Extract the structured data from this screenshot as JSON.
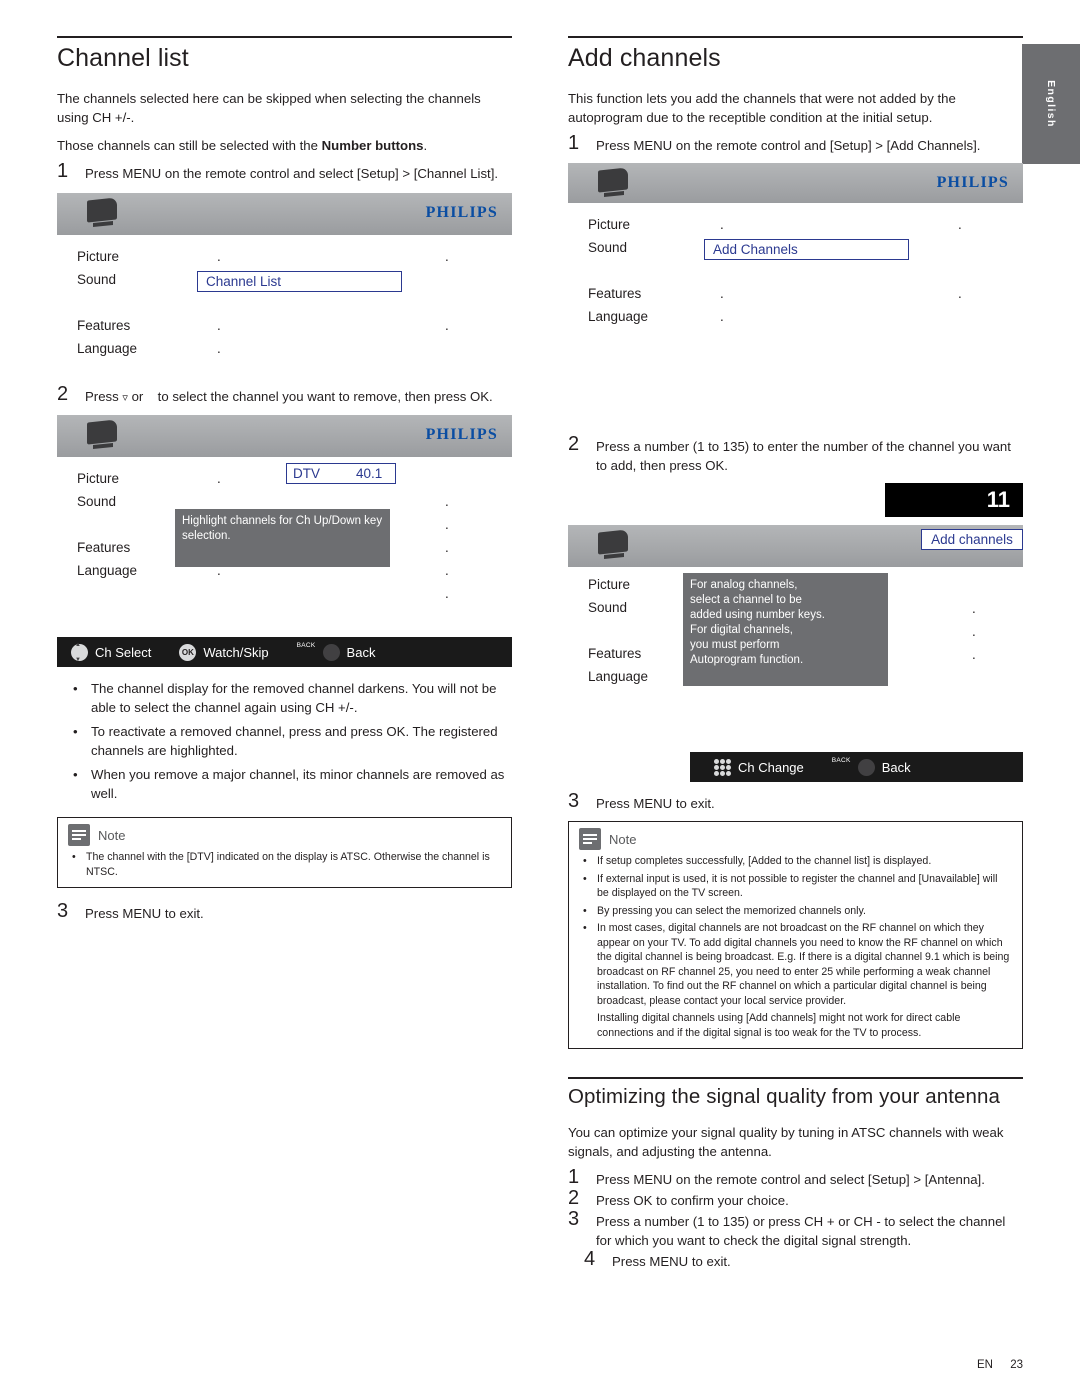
{
  "page": {
    "footer_lang": "EN",
    "footer_page": "23",
    "side_tab": "English"
  },
  "left": {
    "heading": "Channel list",
    "intro1": "The channels selected here can be skipped when selecting the channels using CH +/-.",
    "intro2_a": "Those channels can still be selected with the ",
    "intro2_b": "Number buttons",
    "intro2_c": ".",
    "step1_num": "1",
    "step1": "Press MENU on the remote control and select [Setup] > [Channel List].",
    "osd1": {
      "brand": "PHILIPS",
      "menu": [
        "Picture",
        "Sound",
        "Features",
        "Language"
      ],
      "dots": [
        ".",
        ".",
        ".",
        "."
      ],
      "dots_right": [
        ".",
        ".",
        "."
      ],
      "highlight": "Channel List"
    },
    "step2_num": "2",
    "step2_pre": "Press",
    "step2_mid": "or",
    "step2_post": "to select the channel you want to remove, then press OK.",
    "osd2": {
      "brand": "PHILIPS",
      "menu": [
        "Picture",
        "Sound",
        "Features",
        "Language"
      ],
      "dtv_label": "DTV",
      "dtv_value": "40.1",
      "tip": "Highlight channels for Ch Up/Down key selection.",
      "bar": {
        "ch_select": "Ch Select",
        "watch_skip": "Watch/Skip",
        "ok": "OK",
        "back_badge": "BACK",
        "back": "Back"
      }
    },
    "bullets": [
      "The channel display for the removed channel darkens. You will not be able to select the channel again using CH +/-.",
      "To reactivate a removed channel, press        and press OK. The registered channels are highlighted.",
      "When you remove a major channel, its minor channels are removed as well."
    ],
    "note": {
      "title": "Note",
      "items": [
        "The channel with the [DTV] indicated on the display is ATSC. Otherwise the channel is NTSC."
      ]
    },
    "step3_num": "3",
    "step3": "Press MENU to exit."
  },
  "right": {
    "heading": "Add channels",
    "intro": "This function lets you add the channels that were not added by the autoprogram due to the receptible condition at the initial setup.",
    "step1_num": "1",
    "step1": "Press MENU on the remote control and [Setup] > [Add Channels].",
    "osd1": {
      "brand": "PHILIPS",
      "menu": [
        "Picture",
        "Sound",
        "Features",
        "Language"
      ],
      "highlight": "Add Channels"
    },
    "step2_num": "2",
    "step2": "Press a number (1 to 135) to enter the number of the channel you want to add, then press OK.",
    "channel_number": "11",
    "osd2": {
      "brand": "PHILIPS",
      "menu": [
        "Picture",
        "Sound",
        "Features",
        "Language"
      ],
      "highlight": "Add channels",
      "tip_lines": [
        "For analog channels,",
        "select a channel to be",
        "added using number keys.",
        "For digital channels,",
        "you must perform",
        "Autoprogram function."
      ],
      "bar": {
        "ch_change": "Ch Change",
        "back_badge": "BACK",
        "back": "Back"
      }
    },
    "step3_num": "3",
    "step3": "Press MENU to exit.",
    "note": {
      "title": "Note",
      "items": [
        "If setup completes successfully, [Added to the channel list] is displayed.",
        "If external input is used, it is not possible to register the channel and [Unavailable] will be displayed on the TV screen.",
        "By pressing        you can select the memorized channels only.",
        "In most cases, digital channels are not broadcast on the RF channel on which they appear on your TV. To add digital channels you need to know the RF channel on which the digital channel is being broadcast. E.g. If there is a digital channel 9.1 which is being broadcast on RF channel 25, you need to enter 25 while performing a weak channel installation. To find out the RF channel on which a particular digital channel is being broadcast, please contact your local service provider.",
        "Installing digital channels using [Add channels] might not work for direct cable connections and if the digital signal is too weak for the TV to process."
      ]
    },
    "antenna": {
      "heading": "Optimizing the signal quality from your antenna",
      "intro": "You can optimize your signal quality by tuning in ATSC channels with weak signals, and adjusting the antenna.",
      "steps": [
        {
          "num": "1",
          "text": "Press MENU on the remote control and select [Setup] > [Antenna]."
        },
        {
          "num": "2",
          "text": "Press OK to confirm your choice."
        },
        {
          "num": "3",
          "text": "Press a number (1 to 135) or press CH + or CH - to select the channel for which you want to check the digital signal strength."
        },
        {
          "num": "4",
          "text": "Press MENU to exit."
        }
      ]
    }
  },
  "colors": {
    "brand_blue": "#0a4da2",
    "highlight_blue": "#2b3990",
    "osd_gray": "#6d6e71",
    "text": "#231f20"
  }
}
